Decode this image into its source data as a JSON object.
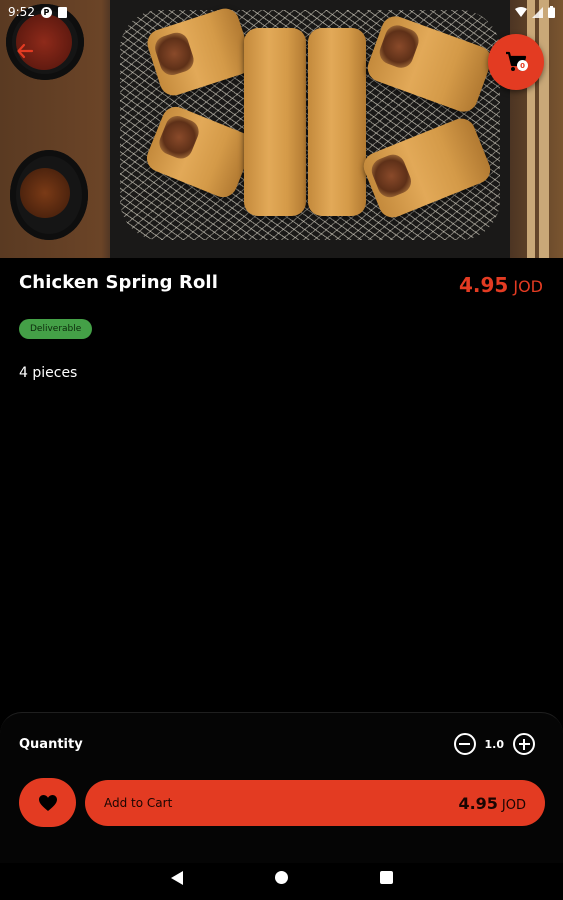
{
  "status_bar": {
    "time": "9:52",
    "notification_icon": "parking-icon",
    "sd_icon": "sd-card-icon",
    "wifi_icon": "wifi-icon",
    "signal_icon": "signal-icon",
    "battery_icon": "battery-icon"
  },
  "header": {
    "back_icon": "arrow-left-icon",
    "cart_icon": "shopping-cart-icon",
    "cart_count": "0"
  },
  "product": {
    "name": "Chicken Spring Roll",
    "price": "4.95",
    "currency": "JOD",
    "badge": "Deliverable",
    "description": "4 pieces"
  },
  "order": {
    "quantity_label": "Quantity",
    "quantity": "1.0",
    "add_to_cart_label": "Add to Cart",
    "total_price": "4.95",
    "currency": "JOD"
  },
  "colors": {
    "accent": "#e33b22",
    "badge_green": "#44a047",
    "background": "#000000"
  }
}
